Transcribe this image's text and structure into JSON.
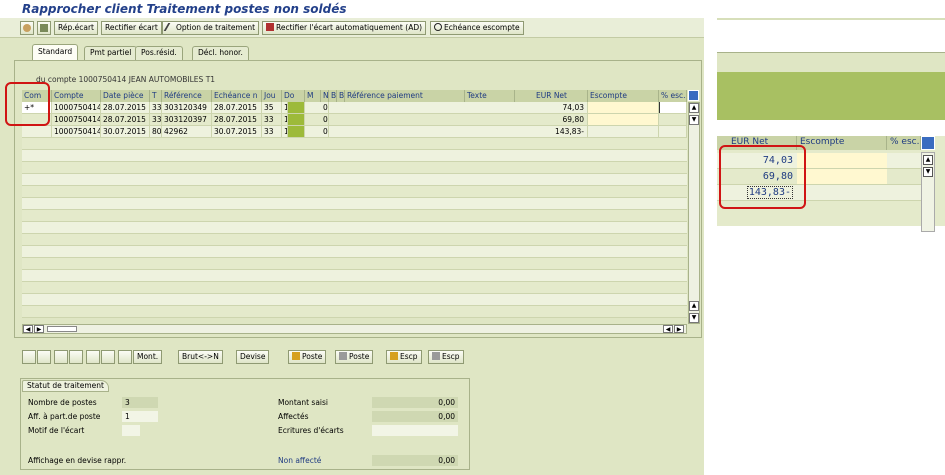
{
  "window": {
    "title": "Rapprocher client Traitement postes non soldés"
  },
  "toolbar": {
    "rep_ecart": "Rép.écart",
    "rectifier_ecart": "Rectifier écart",
    "option_traitement": "Option de traitement",
    "rectifier_auto": "Rectifier l'écart automatiquement (AD)",
    "echeance_escompte": "Echéance escompte"
  },
  "tabs": [
    "Standard",
    "Pmt partiel",
    "Pos.résid.",
    "Décl. honor."
  ],
  "group": {
    "label": "du compte 1000750414 JEAN AUTOMOBILES T1"
  },
  "table": {
    "headers": [
      "Com",
      "Compte",
      "Date pièce",
      "T",
      "Référence",
      "Echéance n",
      "Jou",
      "Do",
      "M",
      "N",
      "B",
      "B",
      "Référence paiement",
      "Texte",
      "EUR Net",
      "Escompte",
      "% esc."
    ],
    "rows": [
      {
        "com": "+*",
        "compte": "1000750414",
        "date": "28.07.2015",
        "t": "33",
        "ref": "303120349",
        "ech": "28.07.2015",
        "jou": "35",
        "do": "1",
        "n": "0",
        "eur": "74,03"
      },
      {
        "com": "",
        "compte": "1000750414",
        "date": "28.07.2015",
        "t": "33",
        "ref": "303120397",
        "ech": "28.07.2015",
        "jou": "33",
        "do": "1",
        "n": "0",
        "eur": "69,80"
      },
      {
        "com": "",
        "compte": "1000750414",
        "date": "30.07.2015",
        "t": "80",
        "ref": "42962",
        "ech": "30.07.2015",
        "jou": "33",
        "do": "1",
        "n": "0",
        "eur": "143,83-"
      }
    ]
  },
  "bottom_toolbar": {
    "mont": "Mont.",
    "brut_net": "Brut<->N",
    "devise": "Devise",
    "poste1": "Poste",
    "poste2": "Poste",
    "escp1": "Escp",
    "escp2": "Escp"
  },
  "status": {
    "title": "Statut de traitement",
    "nombre_postes_label": "Nombre de postes",
    "nombre_postes": "3",
    "aff_label": "Aff. à part.de poste",
    "aff": "1",
    "motif_label": "Motif de l'écart",
    "affichage_label": "Affichage en devise rappr.",
    "montant_saisi_label": "Montant saisi",
    "montant_saisi": "0,00",
    "affectes_label": "Affectés",
    "affectes": "0,00",
    "ecritures_label": "Ecritures d'écarts",
    "non_affecte_label": "Non affecté",
    "non_affecte": "0,00"
  },
  "zoom": {
    "headers": [
      "EUR Net",
      "Escompte",
      "% esc."
    ],
    "values": [
      "74,03",
      "69,80",
      "143,83-"
    ]
  },
  "colors": {
    "accent": "#23408a",
    "highlight": "#d01414",
    "panel": "#dfe6c4"
  }
}
